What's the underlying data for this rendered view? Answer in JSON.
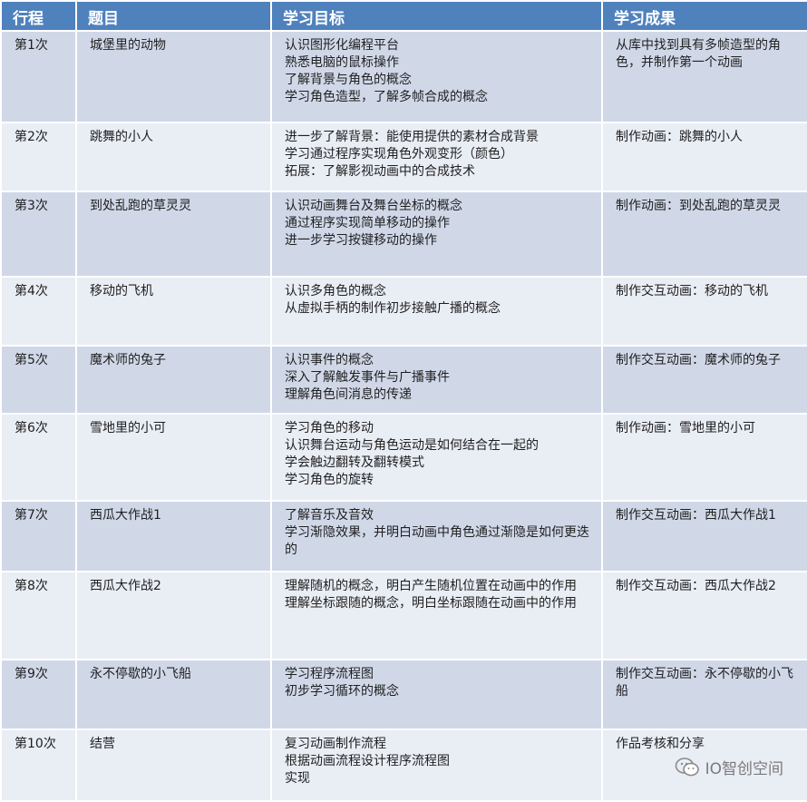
{
  "headers": [
    "行程",
    "题目",
    "学习目标",
    "学习成果"
  ],
  "rows": [
    {
      "session": "第1次",
      "title": "城堡里的动物",
      "goals": [
        "认识图形化编程平台",
        "熟悉电脑的鼠标操作",
        "了解背景与角色的概念",
        "学习角色造型，了解多帧合成的概念"
      ],
      "outcome": "从库中找到具有多帧造型的角色，并制作第一个动画"
    },
    {
      "session": "第2次",
      "title": "跳舞的小人",
      "goals": [
        "进一步了解背景：能使用提供的素材合成背景",
        "学习通过程序实现角色外观变形（颜色）",
        "拓展：了解影视动画中的合成技术"
      ],
      "outcome": "制作动画：跳舞的小人"
    },
    {
      "session": "第3次",
      "title": "到处乱跑的草灵灵",
      "goals": [
        "认识动画舞台及舞台坐标的概念",
        "通过程序实现简单移动的操作",
        "进一步学习按键移动的操作"
      ],
      "outcome": "制作动画：到处乱跑的草灵灵"
    },
    {
      "session": "第4次",
      "title": "移动的飞机",
      "goals": [
        "认识多角色的概念",
        "从虚拟手柄的制作初步接触广播的概念"
      ],
      "outcome": "制作交互动画：移动的飞机"
    },
    {
      "session": "第5次",
      "title": "魔术师的兔子",
      "goals": [
        "认识事件的概念",
        "深入了解触发事件与广播事件",
        "理解角色间消息的传递"
      ],
      "outcome": "制作交互动画：魔术师的兔子"
    },
    {
      "session": "第6次",
      "title": "雪地里的小可",
      "goals": [
        "学习角色的移动",
        "认识舞台运动与角色运动是如何结合在一起的",
        "学会触边翻转及翻转模式",
        "学习角色的旋转"
      ],
      "outcome": "制作动画：雪地里的小可"
    },
    {
      "session": "第7次",
      "title": "西瓜大作战1",
      "goals": [
        "了解音乐及音效",
        "学习渐隐效果，并明白动画中角色通过渐隐是如何更迭的"
      ],
      "outcome": "制作交互动画：西瓜大作战1"
    },
    {
      "session": "第8次",
      "title": "西瓜大作战2",
      "goals": [
        "理解随机的概念，明白产生随机位置在动画中的作用",
        "理解坐标跟随的概念，明白坐标跟随在动画中的作用"
      ],
      "outcome": "制作交互动画：西瓜大作战2"
    },
    {
      "session": "第9次",
      "title": "永不停歇的小飞船",
      "goals": [
        "学习程序流程图",
        "初步学习循环的概念"
      ],
      "outcome": "制作交互动画：永不停歇的小飞船"
    },
    {
      "session": "第10次",
      "title": "结营",
      "goals": [
        "复习动画制作流程",
        "根据动画流程设计程序流程图",
        "实现"
      ],
      "outcome": "作品考核和分享"
    }
  ],
  "watermark": {
    "text": "IO智创空间",
    "icon": "wechat-icon"
  },
  "colors": {
    "header": "#4f81bd",
    "row_odd": "#d0d8e8",
    "row_even": "#e9edf4"
  }
}
